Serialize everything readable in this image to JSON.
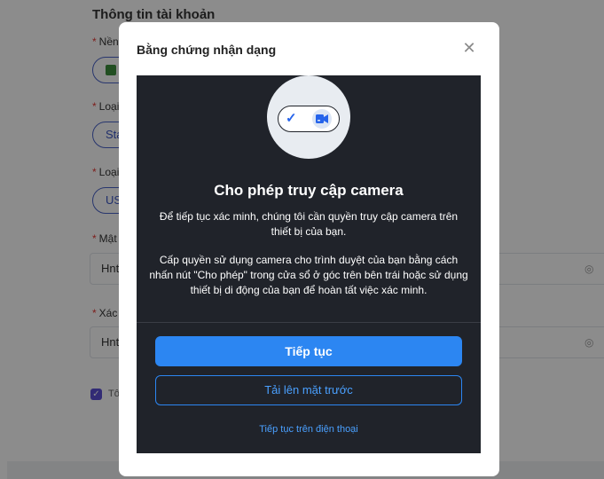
{
  "background": {
    "heading": "Thông tin tài khoản",
    "fields": [
      {
        "label": "Nền t",
        "value": "M"
      },
      {
        "label": "Loại t",
        "value": "Sta"
      },
      {
        "label": "Loại t",
        "value": "USD"
      },
      {
        "label": "Mật k",
        "value": "Hntb"
      },
      {
        "label": "Xác n",
        "value": "Hntb"
      }
    ],
    "checkbox_label": "Tôi x"
  },
  "modal": {
    "title": "Bằng chứng nhận dạng",
    "close_icon": "close-icon",
    "heading": "Cho phép truy cập camera",
    "text1": "Để tiếp tục xác minh, chúng tôi cần quyền truy cập camera trên thiết bị của bạn.",
    "text2": "Cấp quyền sử dụng camera cho trình duyệt của bạn bằng cách nhấn nút \"Cho phép\" trong cửa sổ ở góc trên bên trái hoặc sử dụng thiết bị di động của bạn để hoàn tất việc xác minh.",
    "continue_button": "Tiếp tục",
    "upload_button": "Tải lên mặt trước",
    "phone_link": "Tiếp tục trên điện thoại"
  },
  "colors": {
    "primary": "#2c86f2",
    "panel": "#20232a"
  }
}
